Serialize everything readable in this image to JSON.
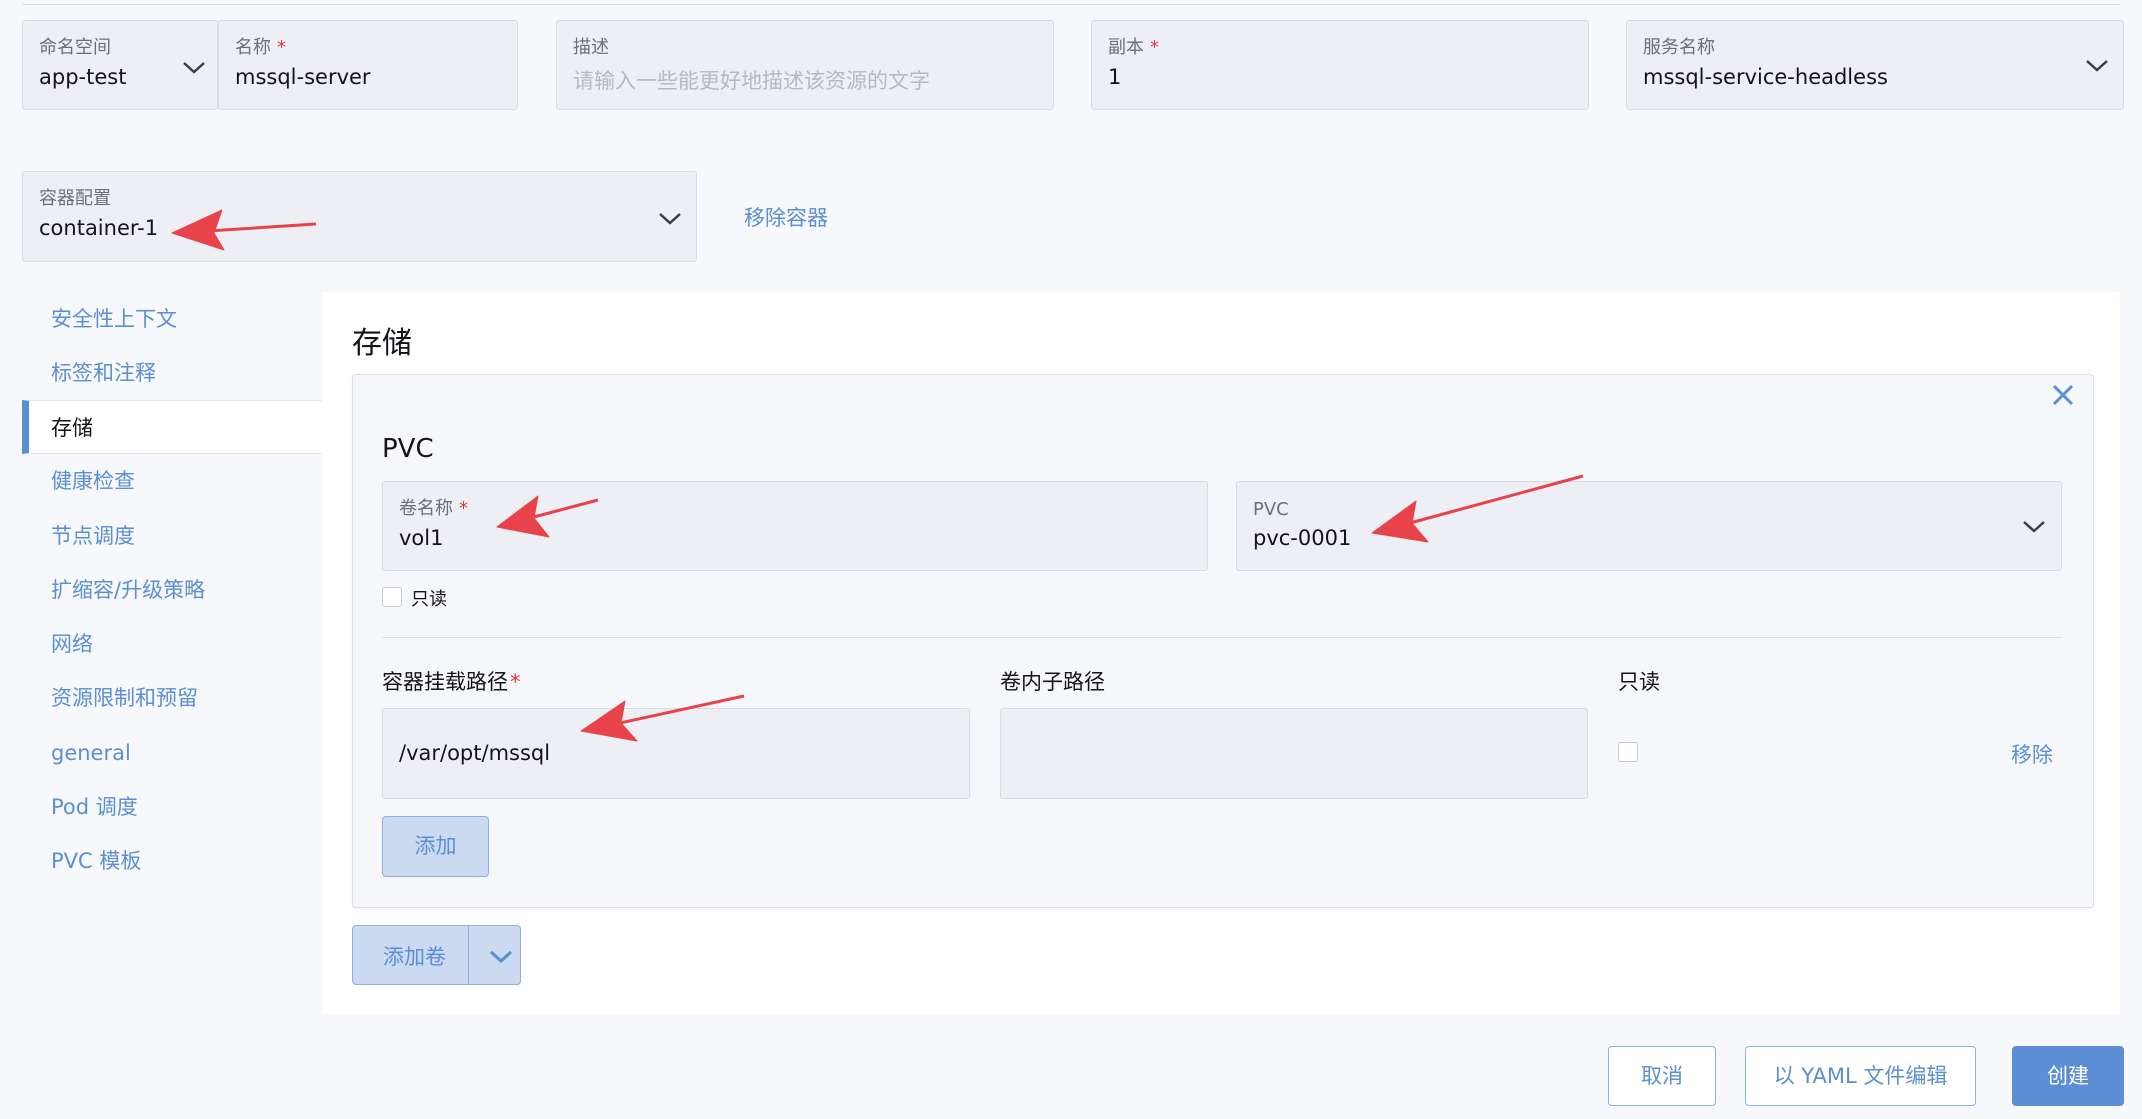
{
  "header_fields": {
    "namespace": {
      "label": "命名空间",
      "value": "app-test"
    },
    "name": {
      "label": "名称",
      "required_mark": "*",
      "value": "mssql-server"
    },
    "description": {
      "label": "描述",
      "placeholder": "请输入一些能更好地描述该资源的文字"
    },
    "replicas": {
      "label": "副本",
      "required_mark": "*",
      "value": "1"
    },
    "service_name": {
      "label": "服务名称",
      "value": "mssql-service-headless"
    }
  },
  "container": {
    "label": "容器配置",
    "value": "container-1",
    "remove_label": "移除容器"
  },
  "sidebar": {
    "items": [
      {
        "label": "安全性上下文"
      },
      {
        "label": "标签和注释"
      },
      {
        "label": "存储",
        "active": true
      },
      {
        "label": "健康检查"
      },
      {
        "label": "节点调度"
      },
      {
        "label": "扩缩容/升级策略"
      },
      {
        "label": "网络"
      },
      {
        "label": "资源限制和预留"
      },
      {
        "label": "general"
      },
      {
        "label": "Pod 调度"
      },
      {
        "label": "PVC 模板"
      }
    ]
  },
  "storage": {
    "title": "存储",
    "card_title": "PVC",
    "volume_name": {
      "label": "卷名称",
      "required_mark": "*",
      "value": "vol1"
    },
    "pvc": {
      "label": "PVC",
      "value": "pvc-0001"
    },
    "readonly_label": "只读",
    "mount": {
      "col_mount_path": "容器挂载路径",
      "required_mark": "*",
      "col_sub_path": "卷内子路径",
      "col_readonly": "只读",
      "row": {
        "mount_path": "/var/opt/mssql",
        "sub_path": ""
      },
      "remove_label": "移除",
      "add_label": "添加"
    },
    "add_volume_label": "添加卷"
  },
  "footer": {
    "cancel_label": "取消",
    "yaml_label": "以 YAML 文件编辑",
    "create_label": "创建"
  },
  "colors": {
    "accent": "#5b8ed2",
    "annotation_arrow": "#e8424a",
    "required": "#e0353c"
  }
}
